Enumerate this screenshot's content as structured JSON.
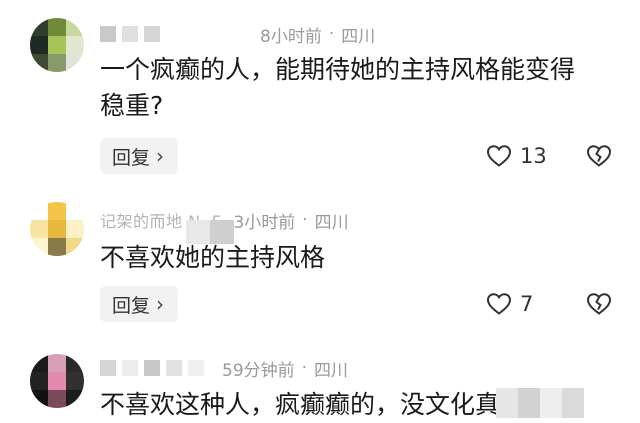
{
  "comments": [
    {
      "time": "8小时前",
      "location": "四川",
      "text_line1": "一个疯癫的人，能期待她的主持风格能变得",
      "text_line2": "稳重?",
      "reply_label": "回复",
      "likes": "13"
    },
    {
      "name_fragment": "记架的而地 N··F",
      "time": "3小时前",
      "location": "四川",
      "text_line1": "不喜欢她的主持风格",
      "reply_label": "回复",
      "likes": "7"
    },
    {
      "time": "59分钟前",
      "location": "四川",
      "text_line1": "不喜欢这种人，疯癫癫的，没文化真可怕"
    }
  ],
  "separator": "·",
  "icons": {
    "like": "heart-outline-icon",
    "dislike": "broken-heart-icon",
    "reply_chevron": "chevron-right-icon"
  },
  "colors": {
    "meta": "#9a9a9a",
    "text": "#1a1a1a",
    "reply_bg": "#f2f2f2"
  }
}
